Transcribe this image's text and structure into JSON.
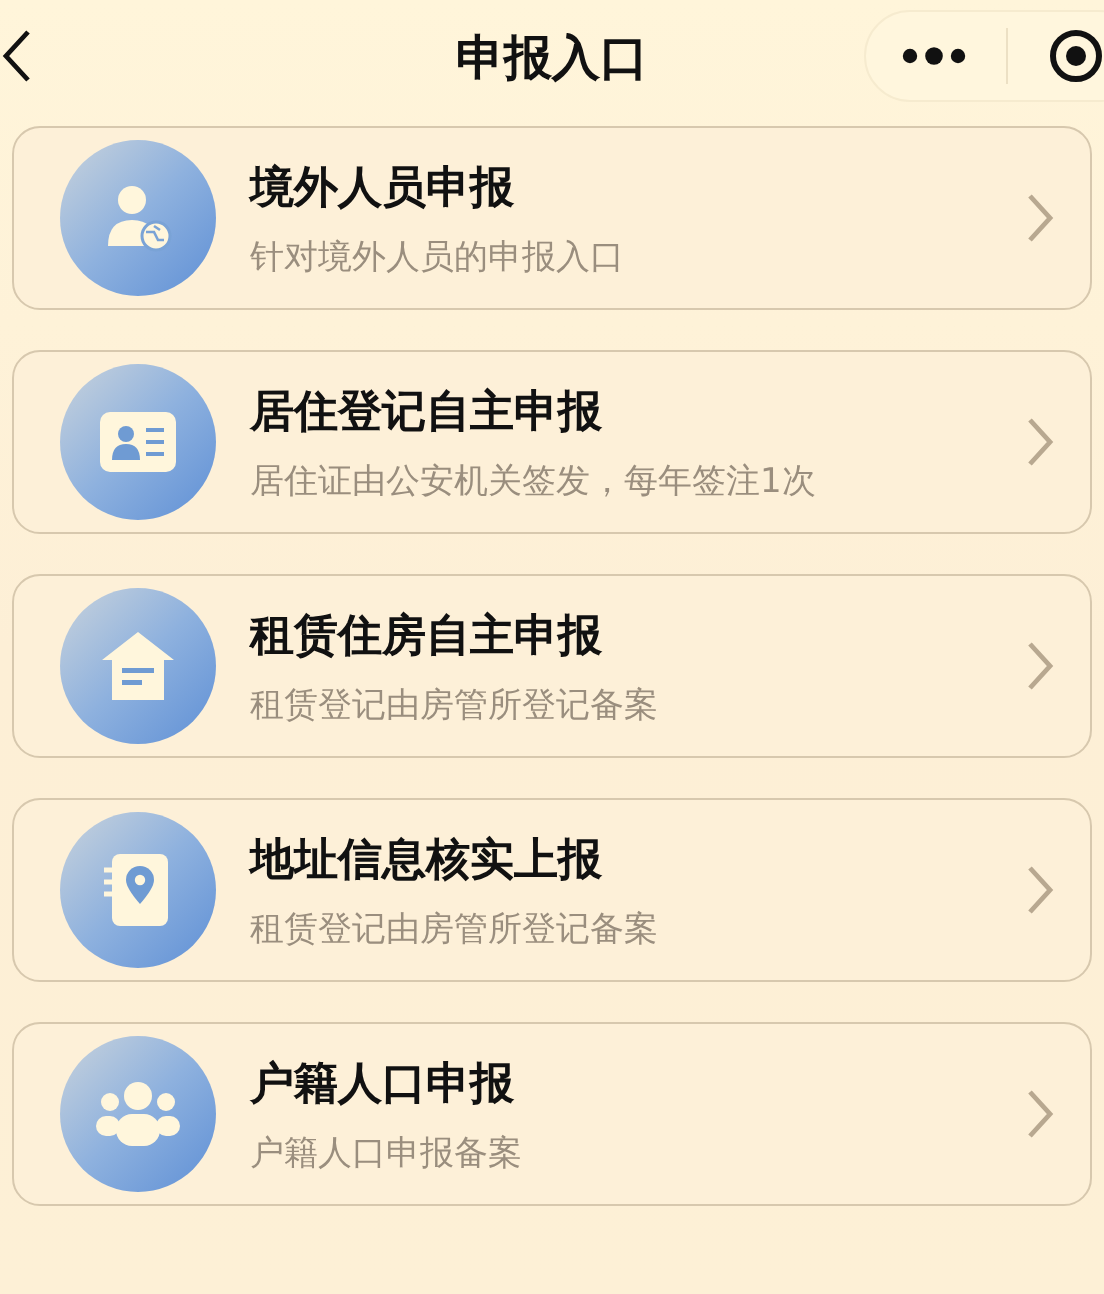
{
  "header": {
    "title": "申报入口"
  },
  "entries": [
    {
      "kind": "foreigner",
      "title": "境外人员申报",
      "subtitle": "针对境外人员的申报入口"
    },
    {
      "kind": "residence",
      "title": "居住登记自主申报",
      "subtitle": "居住证由公安机关签发，每年签注1次"
    },
    {
      "kind": "rental",
      "title": "租赁住房自主申报",
      "subtitle": "租赁登记由房管所登记备案"
    },
    {
      "kind": "address",
      "title": "地址信息核实上报",
      "subtitle": "租赁登记由房管所登记备案"
    },
    {
      "kind": "household",
      "title": "户籍人口申报",
      "subtitle": "户籍人口申报备案"
    }
  ]
}
